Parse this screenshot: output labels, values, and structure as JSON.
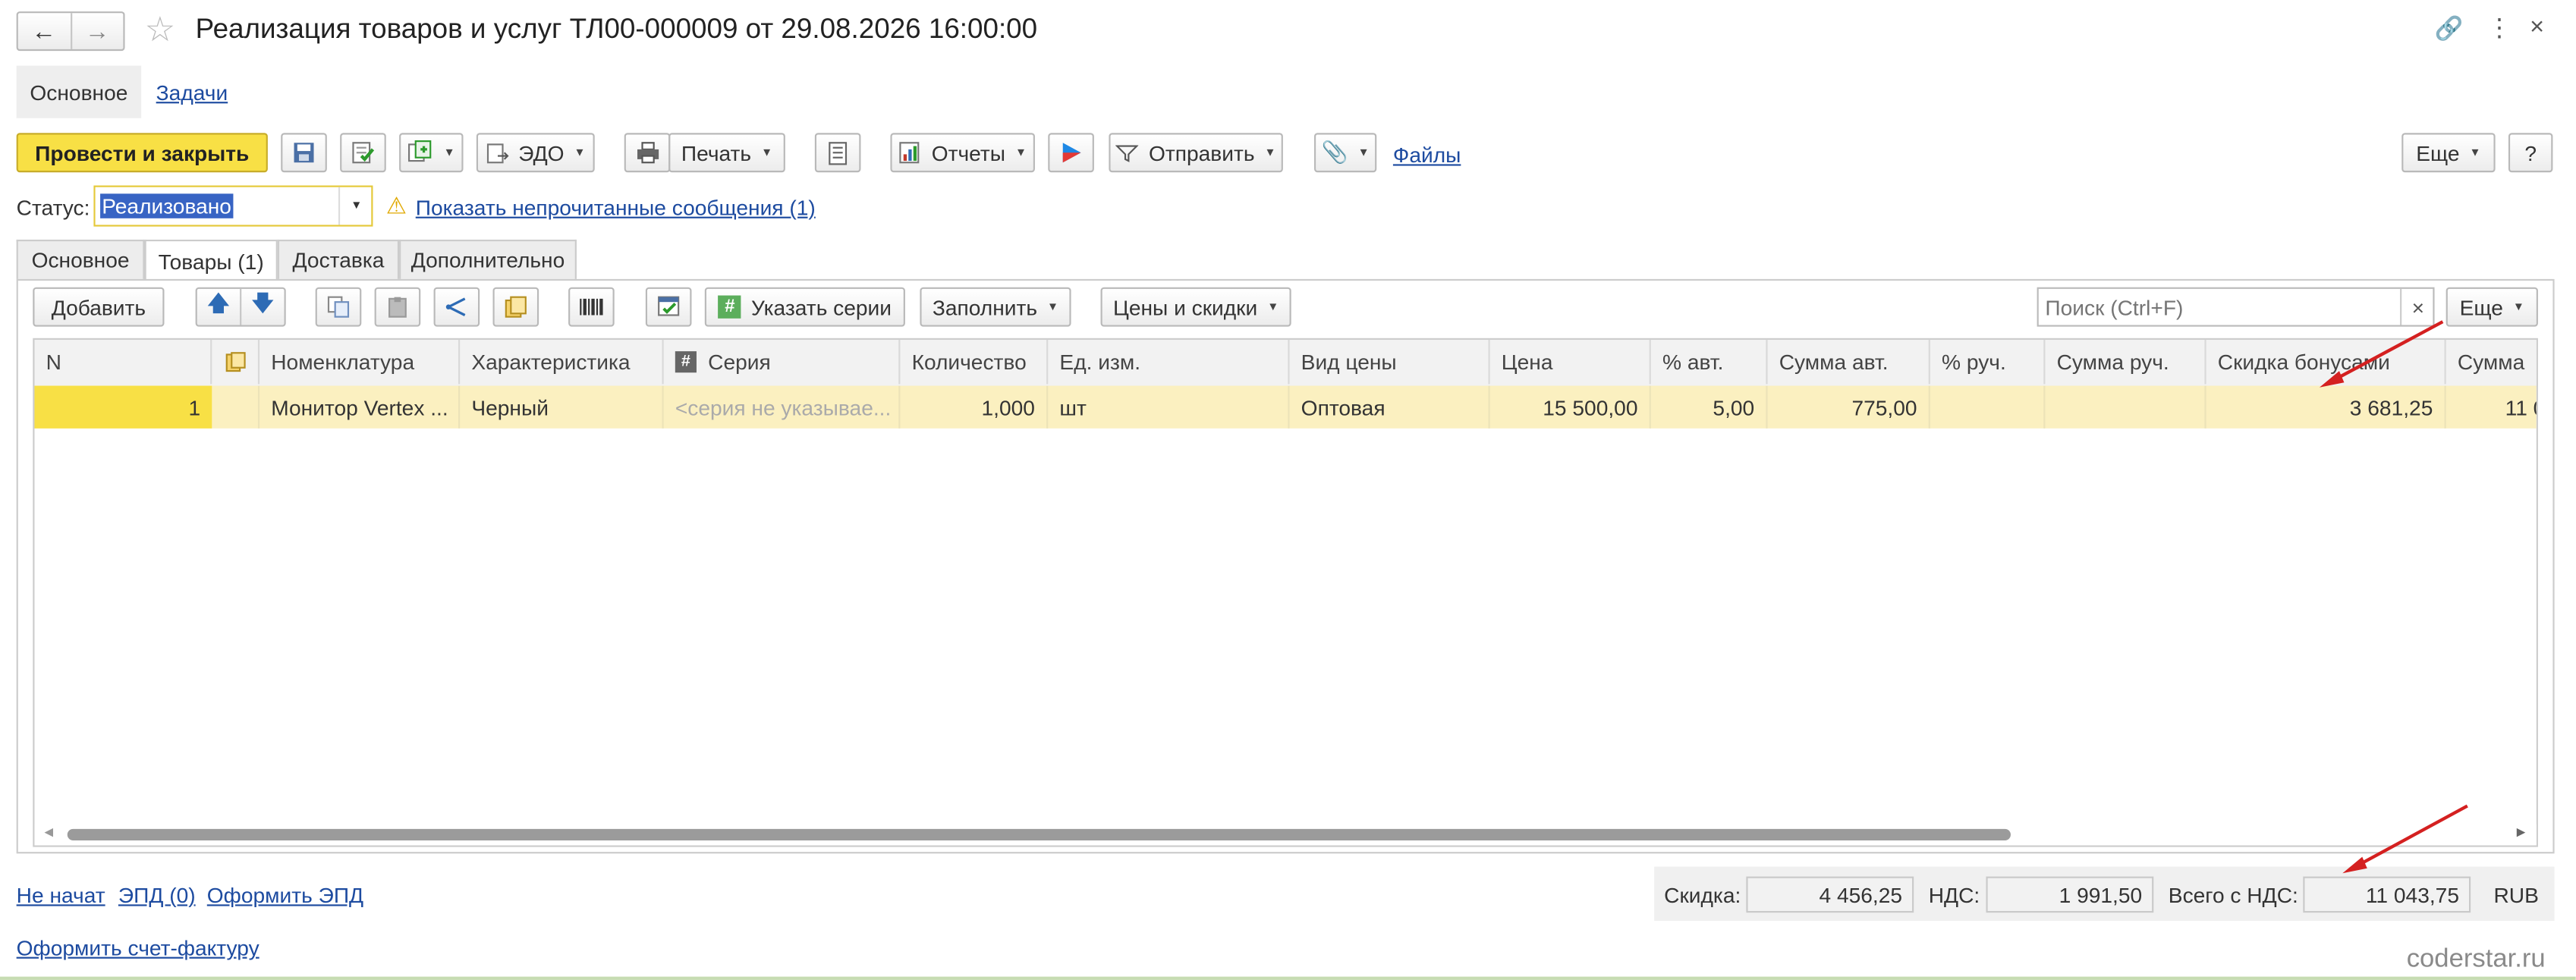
{
  "window": {
    "title": "Реализация товаров и услуг ТЛ00-000009 от 29.08.2026 16:00:00"
  },
  "top_tabs": {
    "main": "Основное",
    "tasks": "Задачи"
  },
  "toolbar": {
    "post_close": "Провести и закрыть",
    "edo": "ЭДО",
    "print": "Печать",
    "reports": "Отчеты",
    "send": "Отправить",
    "files": "Файлы",
    "more": "Еще",
    "help": "?"
  },
  "status": {
    "label": "Статус:",
    "value": "Реализовано",
    "unread_link": "Показать непрочитанные сообщения (1)"
  },
  "form_tabs": [
    "Основное",
    "Товары (1)",
    "Доставка",
    "Дополнительно"
  ],
  "table_toolbar": {
    "add": "Добавить",
    "series": "Указать серии",
    "fill": "Заполнить",
    "prices": "Цены и скидки",
    "search_placeholder": "Поиск (Ctrl+F)",
    "more": "Еще"
  },
  "table": {
    "columns": [
      "N",
      "Номенклатура",
      "Характеристика",
      "Серия",
      "Количество",
      "Ед. изм.",
      "Вид цены",
      "Цена",
      "% авт.",
      "Сумма авт.",
      "% руч.",
      "Сумма руч.",
      "Скидка бонусами",
      "Сумма"
    ],
    "rows": [
      {
        "n": "1",
        "item": "Монитор Vertex ...",
        "characteristic": "Черный",
        "series": "<серия не указывае...",
        "qty": "1,000",
        "unit": "шт",
        "price_type": "Оптовая",
        "price": "15 500,00",
        "auto_pct": "5,00",
        "auto_sum": "775,00",
        "manual_pct": "",
        "manual_sum": "",
        "bonus_discount": "3 681,25",
        "sum": "11 0"
      }
    ]
  },
  "footer": {
    "not_started": "Не начат",
    "epd": "ЭПД (0)",
    "make_epd": "Оформить ЭПД",
    "make_invoice": "Оформить счет-фактуру",
    "discount_label": "Скидка:",
    "discount_value": "4 456,25",
    "vat_label": "НДС:",
    "vat_value": "1 991,50",
    "total_label": "Всего с НДС:",
    "total_value": "11 043,75",
    "currency": "RUB"
  },
  "watermark": "coderstar.ru",
  "colors": {
    "accent_yellow": "#f8e045",
    "row_highlight": "#fbf0c0",
    "link": "#1d4ba0",
    "annotation_arrow": "#d42020"
  }
}
